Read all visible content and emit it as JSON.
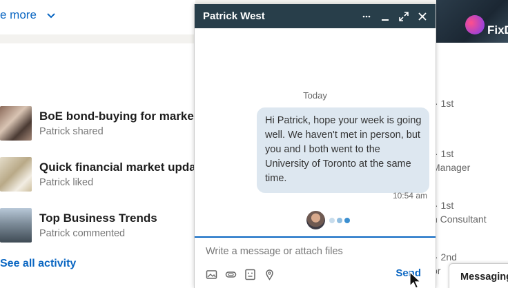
{
  "left": {
    "see_more": "e more",
    "activities": [
      {
        "title": "BoE bond-buying for markets",
        "subtitle": "Patrick shared"
      },
      {
        "title": "Quick financial market update",
        "subtitle": "Patrick liked"
      },
      {
        "title": "Top Business Trends",
        "subtitle": "Patrick commented"
      }
    ],
    "see_all": "See all activity"
  },
  "right": {
    "promo_text": "FixD",
    "connections": [
      {
        "degree": "· 1st",
        "role": ""
      },
      {
        "degree": "· 1st",
        "role": "Manager"
      },
      {
        "degree": "· 1st",
        "role": "n Consultant"
      },
      {
        "degree": "· 2nd",
        "role": "or"
      }
    ],
    "messaging_label": "Messaging"
  },
  "chat": {
    "name": "Patrick West",
    "day_label": "Today",
    "message": "Hi Patrick, hope your week is going well. We haven't met in person, but you and I both went to the University of Toronto at the same time.",
    "time": "10:54 am",
    "compose_placeholder": "Write a message or attach files",
    "send_label": "Send",
    "header_icons": [
      "more-icon",
      "minimize-icon",
      "expand-icon",
      "close-icon"
    ],
    "tool_icons": [
      "image-icon",
      "attachment-icon",
      "gif-icon",
      "location-icon"
    ]
  },
  "colors": {
    "header": "#283e4a",
    "accent": "#0a66c2",
    "bubble": "#dde7f0",
    "typing_dots": [
      "#c7dcec",
      "#8fbde0",
      "#3b8fd0"
    ]
  }
}
